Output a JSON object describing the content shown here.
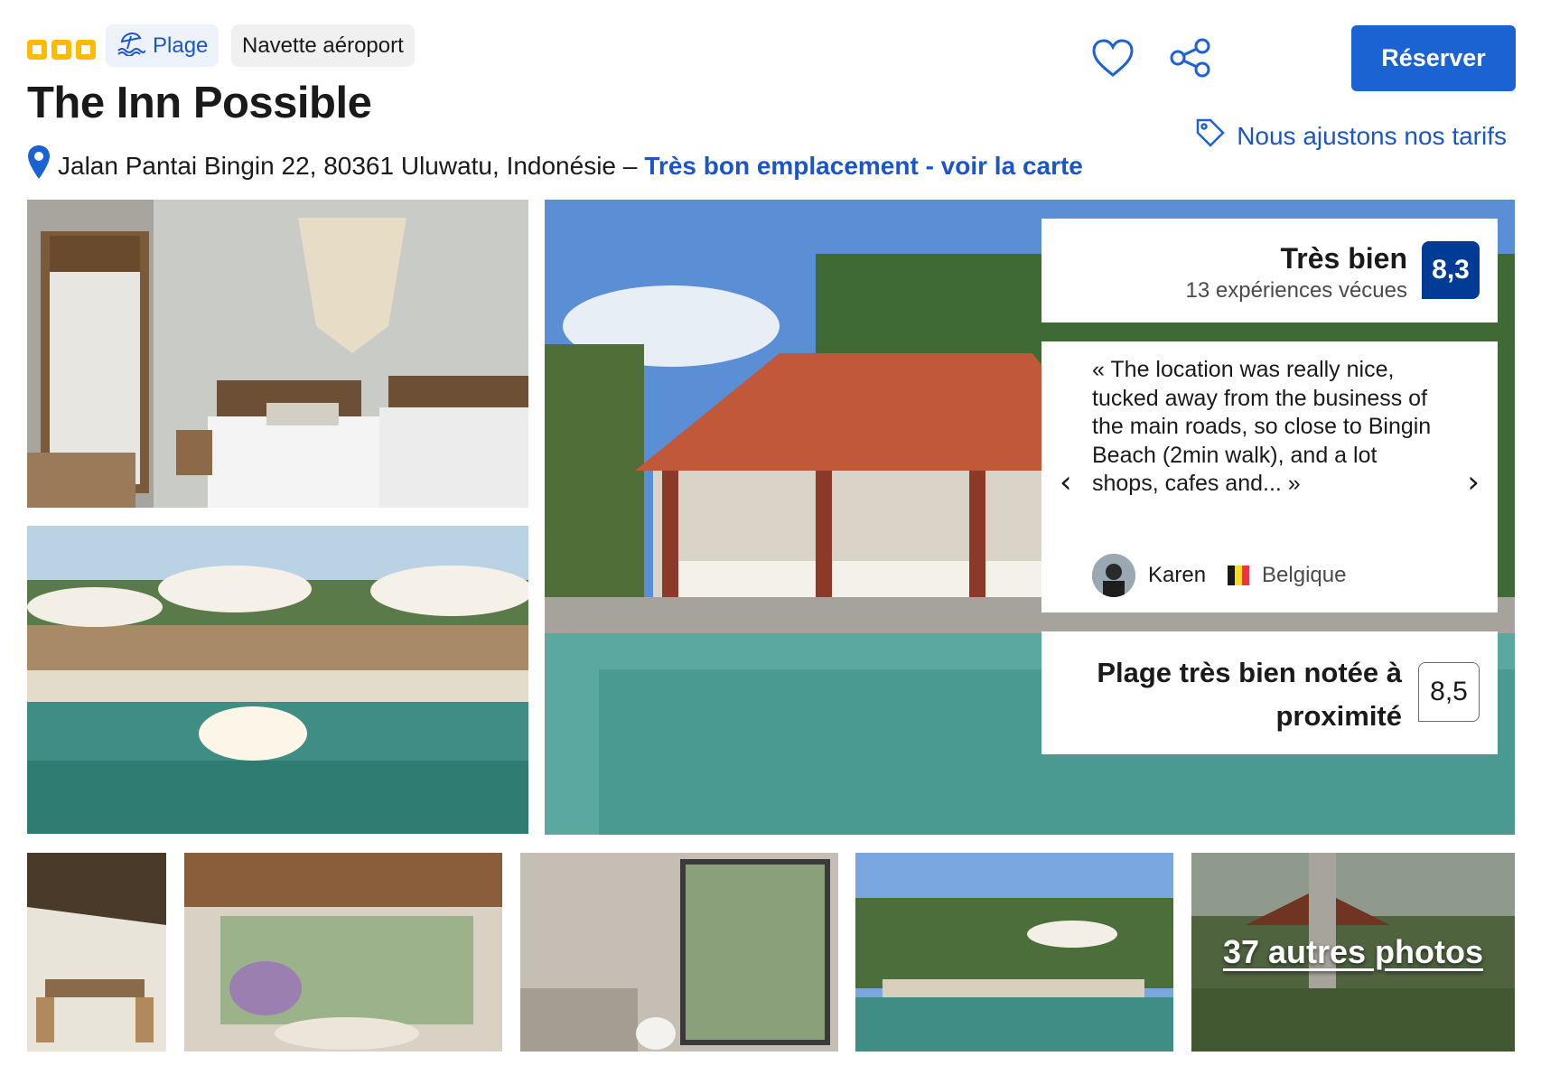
{
  "header": {
    "star_count": 3,
    "tags": {
      "beach": "Plage",
      "shuttle": "Navette aéroport"
    },
    "title": "The Inn Possible",
    "address": "Jalan Pantai Bingin 22, 80361 Uluwatu, Indonésie –",
    "map_link": "Très bon emplacement - voir la carte",
    "reserve_label": "Réserver",
    "pricing_note": "Nous ajustons nos tarifs"
  },
  "score": {
    "label": "Très bien",
    "reviews": "13 expériences vécues",
    "value": "8,3"
  },
  "review": {
    "quote": "« The location was really nice, tucked away from the business of the main roads, so close to Bingin Beach (2min walk), and a lot shops, cafes and... »",
    "reviewer": "Karen",
    "country": "Belgique"
  },
  "beach": {
    "label": "Plage très bien notée à proximité",
    "value": "8,5"
  },
  "gallery": {
    "more_photos": "37 autres photos"
  },
  "colors": {
    "brand": "#1b62d3",
    "link": "#1b56c8",
    "score_bg": "#003b95",
    "star": "#febb02"
  },
  "icons": [
    "star-icon",
    "beach-icon",
    "heart-icon",
    "share-icon",
    "location-pin-icon",
    "price-tag-icon",
    "chevron-left-icon",
    "chevron-right-icon",
    "flag-belgium-icon"
  ]
}
